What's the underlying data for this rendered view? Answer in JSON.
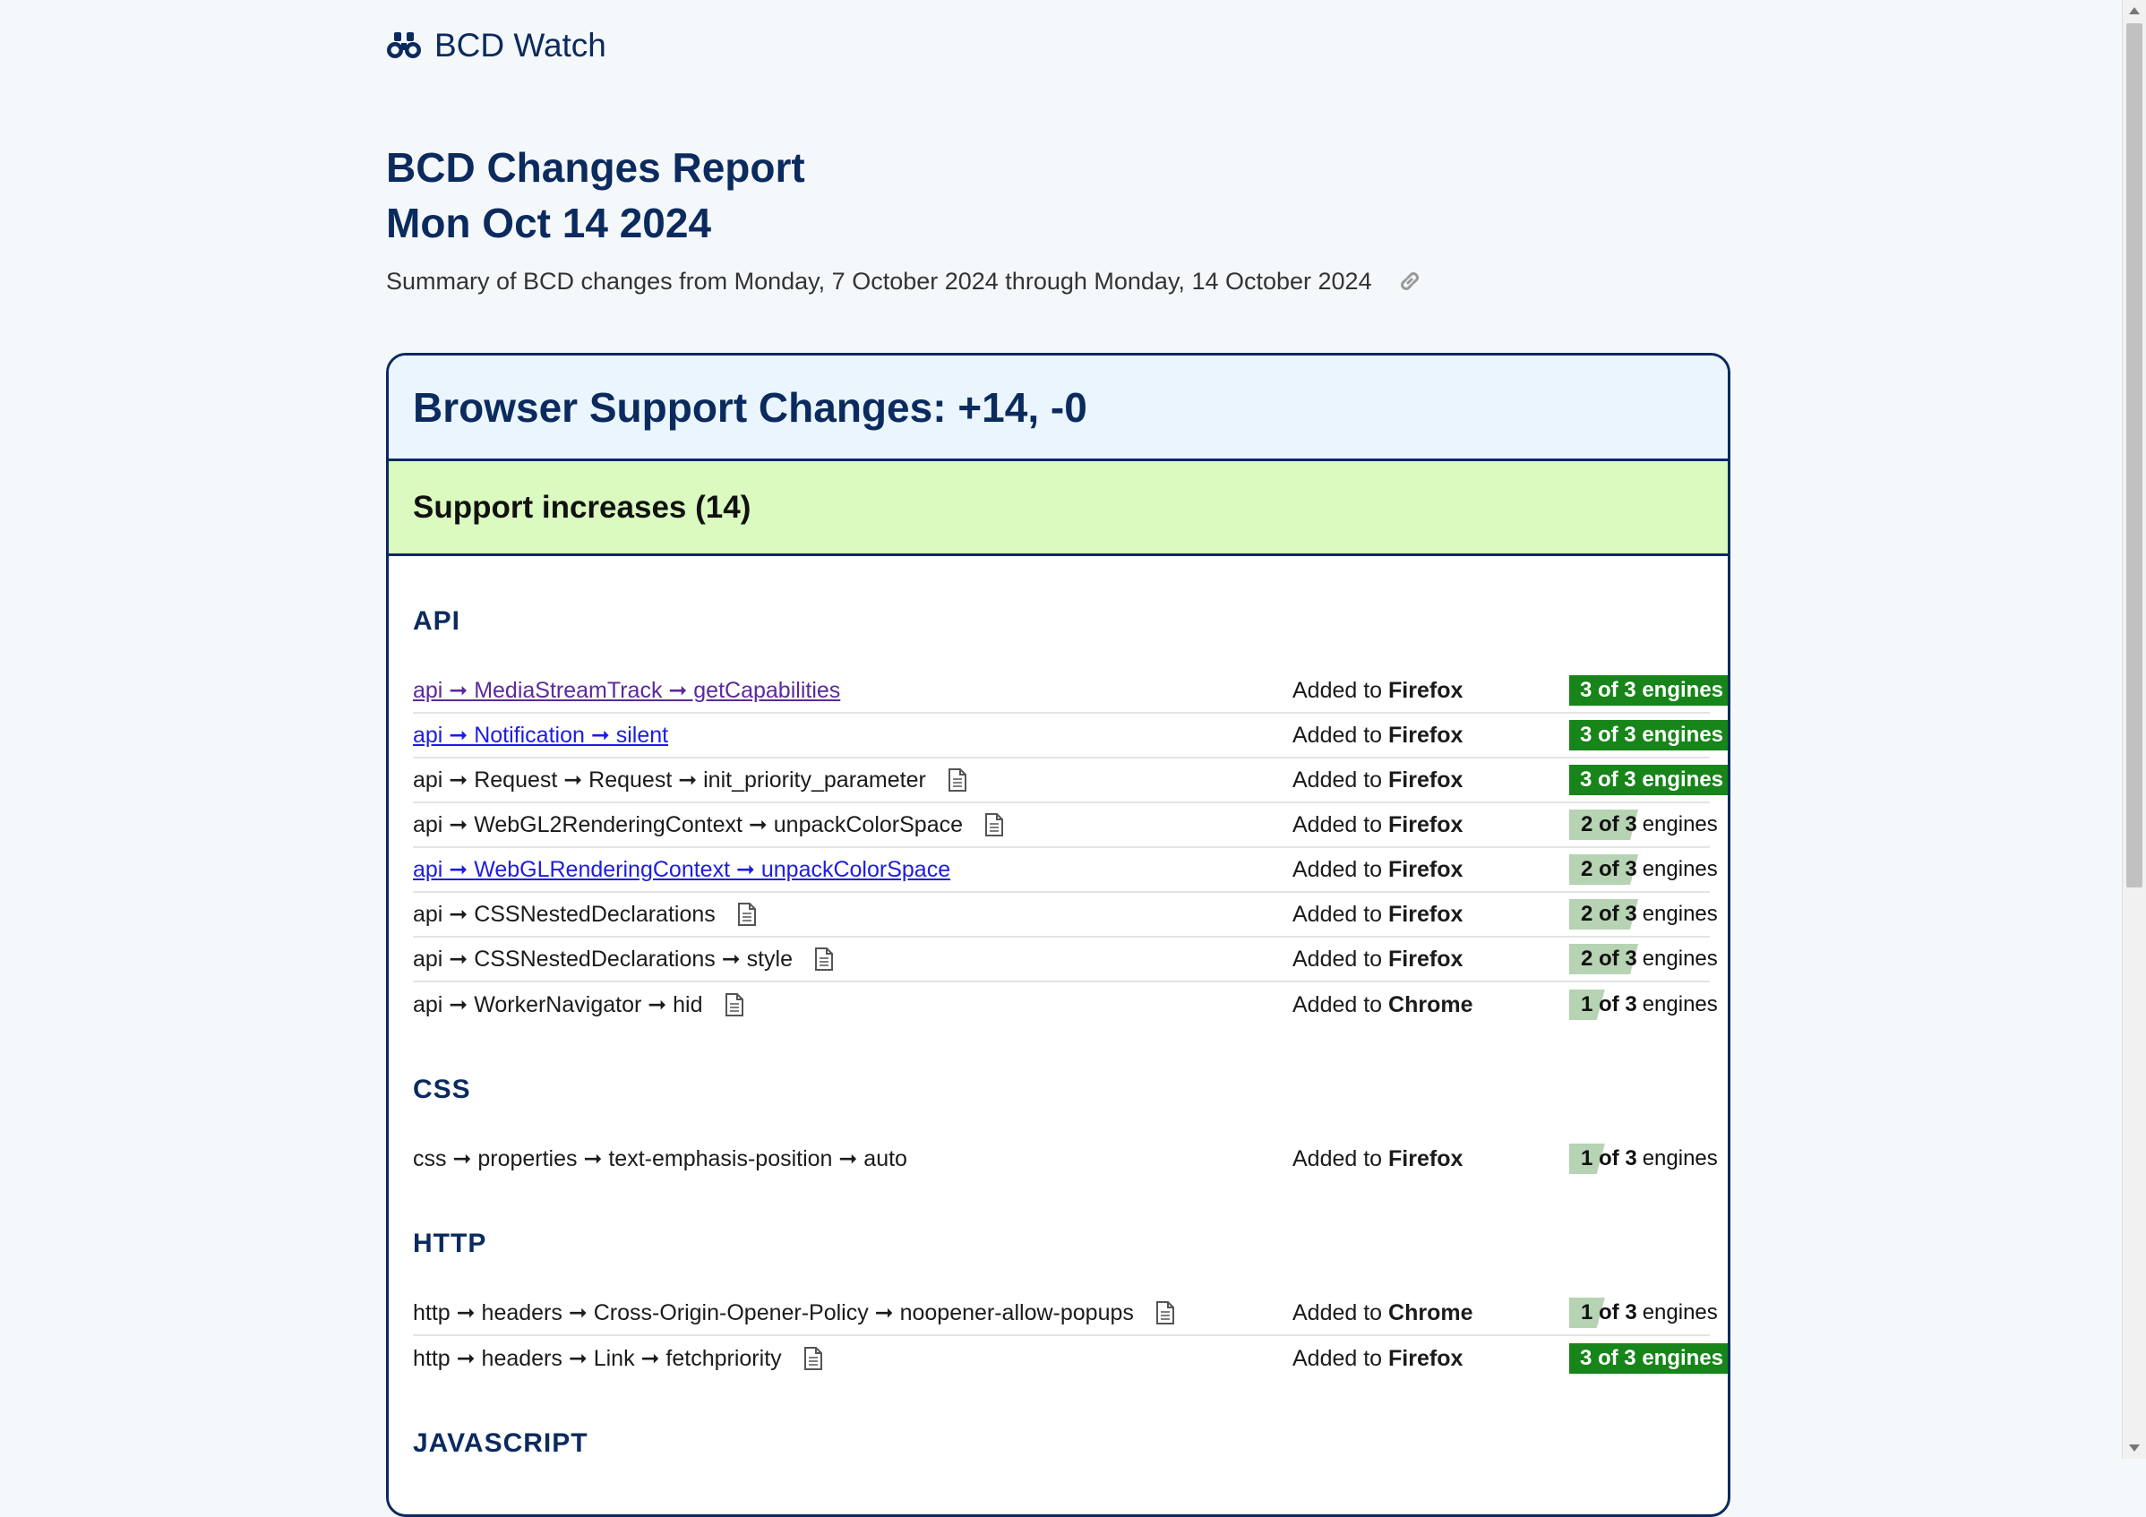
{
  "brand": {
    "name": "BCD Watch"
  },
  "report": {
    "title_line1": "BCD Changes Report",
    "title_line2": "Mon Oct 14 2024",
    "summary": "Summary of BCD changes from Monday, 7 October 2024 through Monday, 14 October 2024"
  },
  "card": {
    "heading": "Browser Support Changes: +14, -0",
    "increases_heading": "Support increases (14)"
  },
  "sections": {
    "api": "API",
    "css": "CSS",
    "http": "HTTP",
    "javascript": "JAVASCRIPT"
  },
  "rows": [
    {
      "feature": "api ➞ MediaStreamTrack ➞ getCapabilities",
      "added_prefix": "Added to ",
      "browser": "Firefox",
      "engines_num": "3 of 3",
      "engines_word": "engines",
      "engines_count": 3
    },
    {
      "feature": "api ➞ Notification ➞ silent",
      "added_prefix": "Added to ",
      "browser": "Firefox",
      "engines_num": "3 of 3",
      "engines_word": "engines",
      "engines_count": 3
    },
    {
      "feature": "api ➞ Request ➞ Request ➞ init_priority_parameter",
      "added_prefix": "Added to ",
      "browser": "Firefox",
      "engines_num": "3 of 3",
      "engines_word": "engines",
      "engines_count": 3
    },
    {
      "feature": "api ➞ WebGL2RenderingContext ➞ unpackColorSpace",
      "added_prefix": "Added to ",
      "browser": "Firefox",
      "engines_num": "2 of 3",
      "engines_word": "engines",
      "engines_count": 2
    },
    {
      "feature": "api ➞ WebGLRenderingContext ➞ unpackColorSpace",
      "added_prefix": "Added to ",
      "browser": "Firefox",
      "engines_num": "2 of 3",
      "engines_word": "engines",
      "engines_count": 2
    },
    {
      "feature": "api ➞ CSSNestedDeclarations",
      "added_prefix": "Added to ",
      "browser": "Firefox",
      "engines_num": "2 of 3",
      "engines_word": "engines",
      "engines_count": 2
    },
    {
      "feature": "api ➞ CSSNestedDeclarations ➞ style",
      "added_prefix": "Added to ",
      "browser": "Firefox",
      "engines_num": "2 of 3",
      "engines_word": "engines",
      "engines_count": 2
    },
    {
      "feature": "api ➞ WorkerNavigator ➞ hid",
      "added_prefix": "Added to ",
      "browser": "Chrome",
      "engines_num": "1 of 3",
      "engines_word": "engines",
      "engines_count": 1
    },
    {
      "feature": "css ➞ properties ➞ text-emphasis-position ➞ auto",
      "added_prefix": "Added to ",
      "browser": "Firefox",
      "engines_num": "1 of 3",
      "engines_word": "engines",
      "engines_count": 1
    },
    {
      "feature": "http ➞ headers ➞ Cross-Origin-Opener-Policy ➞ noopener-allow-popups",
      "added_prefix": "Added to ",
      "browser": "Chrome",
      "engines_num": "1 of 3",
      "engines_word": "engines",
      "engines_count": 1
    },
    {
      "feature": "http ➞ headers ➞ Link ➞ fetchpriority",
      "added_prefix": "Added to ",
      "browser": "Firefox",
      "engines_num": "3 of 3",
      "engines_word": "engines",
      "engines_count": 3
    }
  ],
  "colors": {
    "navy": "#0b2a5e",
    "full_badge": "#17851a",
    "partial_badge": "#b6d3b3",
    "increase_bg": "#dafabf",
    "link": "#1d1de0",
    "visited": "#5a2a9c"
  },
  "icons": {
    "brand": "binoculars-icon",
    "permalink": "link-icon",
    "spec": "document-icon"
  }
}
